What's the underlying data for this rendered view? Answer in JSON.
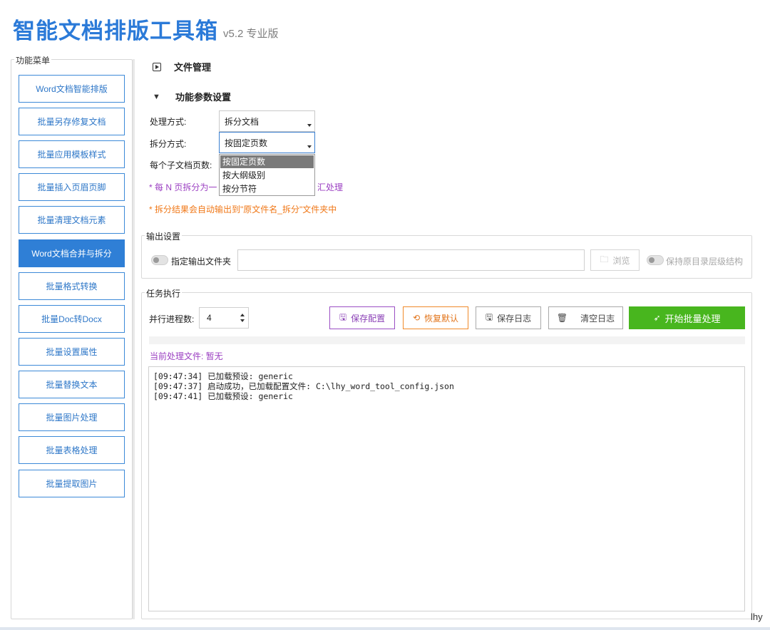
{
  "app": {
    "title": "智能文档排版工具箱",
    "version": "v5.2 专业版"
  },
  "sidebar": {
    "legend": "功能菜单",
    "items": [
      {
        "label": "Word文档智能排版"
      },
      {
        "label": "批量另存修复文档"
      },
      {
        "label": "批量应用模板样式"
      },
      {
        "label": "批量插入页眉页脚"
      },
      {
        "label": "批量清理文档元素"
      },
      {
        "label": "Word文档合并与拆分",
        "active": true
      },
      {
        "label": "批量格式转换"
      },
      {
        "label": "批量Doc转Docx"
      },
      {
        "label": "批量设置属性"
      },
      {
        "label": "批量替换文本"
      },
      {
        "label": "批量图片处理"
      },
      {
        "label": "批量表格处理"
      },
      {
        "label": "批量提取图片"
      }
    ]
  },
  "sections": {
    "file_mgmt": "文件管理",
    "params": "功能参数设置"
  },
  "params": {
    "mode_label": "处理方式:",
    "mode_value": "拆分文档",
    "split_label": "拆分方式:",
    "split_value": "按固定页数",
    "pages_label": "每个子文档页数:",
    "split_options": [
      "按固定页数",
      "按大纲级别",
      "按分节符"
    ],
    "note1_left": "* 每 N 页拆分为一",
    "note1_right": "汇处理",
    "note2": "* 拆分结果会自动输出到\"原文件名_拆分\"文件夹中"
  },
  "output": {
    "legend": "输出设置",
    "specify_label": "指定输出文件夹",
    "path_value": "",
    "browse": "浏览",
    "keep_structure": "保持原目录层级结构"
  },
  "task": {
    "legend": "任务执行",
    "parallel_label": "并行进程数:",
    "parallel_value": "4",
    "save_config": "保存配置",
    "restore_default": "恢复默认",
    "save_log": "保存日志",
    "clear_log": "清空日志",
    "start": "开始批量处理",
    "current_file": "当前处理文件: 暂无",
    "log": [
      "[09:47:34] 已加载预设: generic",
      "[09:47:37] 启动成功，已加载配置文件: C:\\lhy_word_tool_config.json",
      "[09:47:41] 已加载预设: generic"
    ]
  },
  "footer": {
    "author": "lhy"
  },
  "colors": {
    "accent": "#2f7fd6",
    "start": "#48b61e",
    "purple": "#9b3fc2",
    "orange": "#f07818"
  }
}
